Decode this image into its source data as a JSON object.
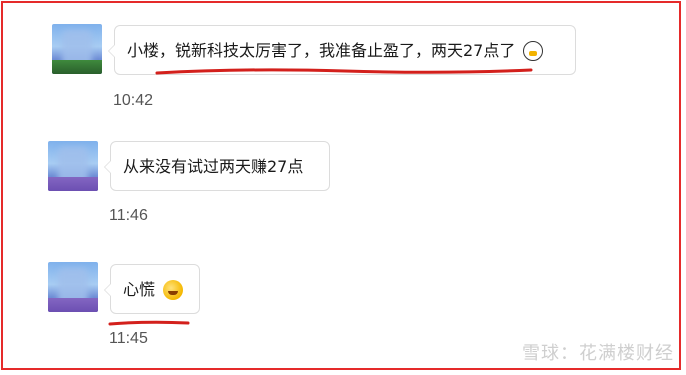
{
  "messages": [
    {
      "text": "小楼，锐新科技太厉害了，我准备止盈了，两天27点了",
      "emoji": "qq-penguin-icon",
      "time": "10:42"
    },
    {
      "text": "从来没有试过两天赚27点",
      "time": "11:46"
    },
    {
      "text": "心慌",
      "emoji": "laughing-crying-emoji",
      "time": "11:45"
    }
  ],
  "watermark": "雪球：花满楼财经",
  "colors": {
    "frame": "#e52a2a",
    "underline": "#d3201c"
  }
}
